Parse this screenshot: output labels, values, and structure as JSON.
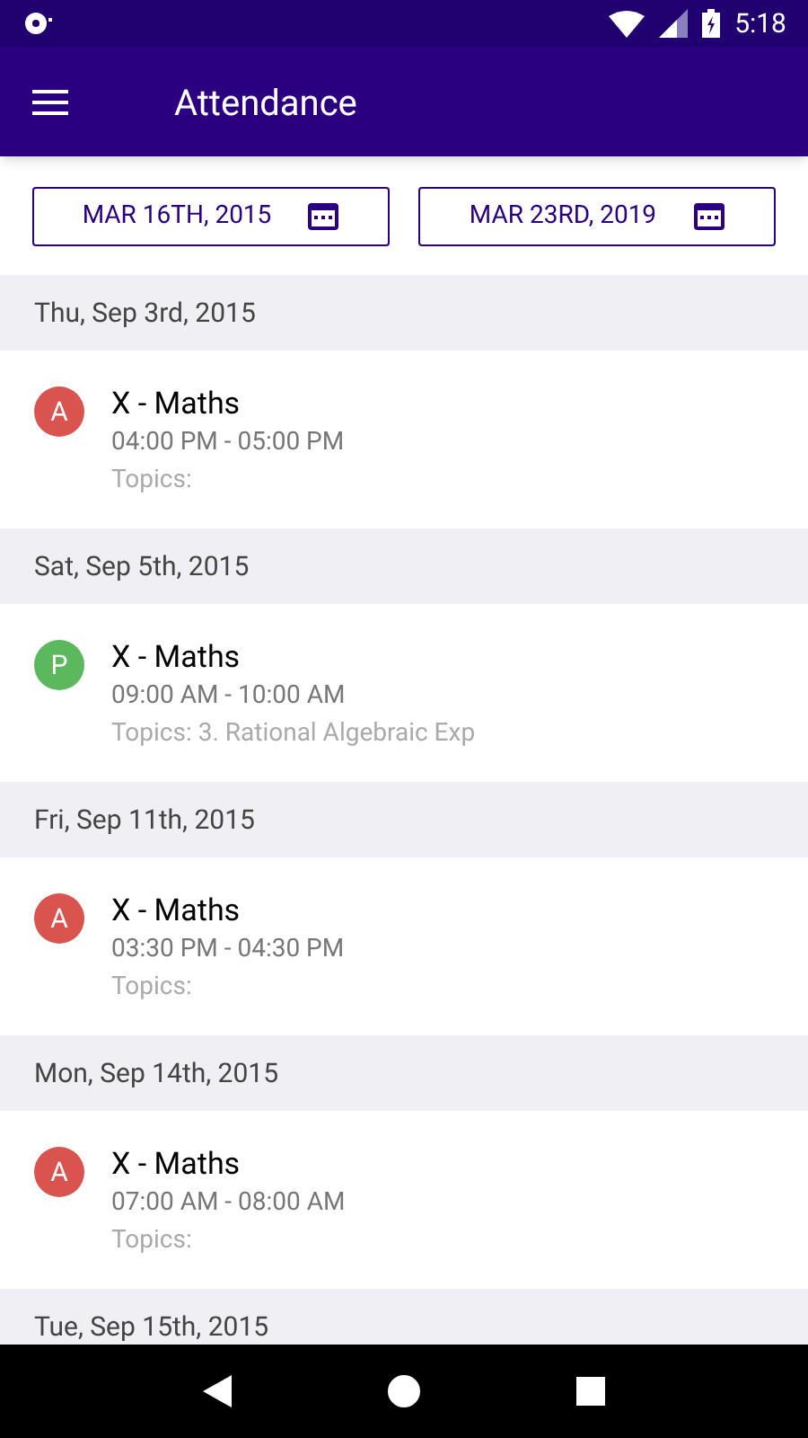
{
  "status_bar": {
    "time": "5:18"
  },
  "app_bar": {
    "title": "Attendance"
  },
  "date_range": [
    {
      "label": "MAR 16TH, 2015"
    },
    {
      "label": "MAR 23RD, 2019"
    }
  ],
  "days": [
    {
      "date": "Thu, Sep 3rd, 2015",
      "entries": [
        {
          "status": "A",
          "color": "#d9534f",
          "subject": "X - Maths",
          "time": "04:00 PM - 05:00 PM",
          "topics": "Topics:"
        }
      ]
    },
    {
      "date": "Sat, Sep 5th, 2015",
      "entries": [
        {
          "status": "P",
          "color": "#5cb85c",
          "subject": "X - Maths",
          "time": "09:00 AM - 10:00 AM",
          "topics": "Topics: 3. Rational Algebraic Exp"
        }
      ]
    },
    {
      "date": "Fri, Sep 11th, 2015",
      "entries": [
        {
          "status": "A",
          "color": "#d9534f",
          "subject": "X - Maths",
          "time": "03:30 PM - 04:30 PM",
          "topics": "Topics:"
        }
      ]
    },
    {
      "date": "Mon, Sep 14th, 2015",
      "entries": [
        {
          "status": "A",
          "color": "#d9534f",
          "subject": "X - Maths",
          "time": "07:00 AM - 08:00 AM",
          "topics": "Topics:"
        }
      ]
    },
    {
      "date": "Tue, Sep 15th, 2015"
    }
  ]
}
